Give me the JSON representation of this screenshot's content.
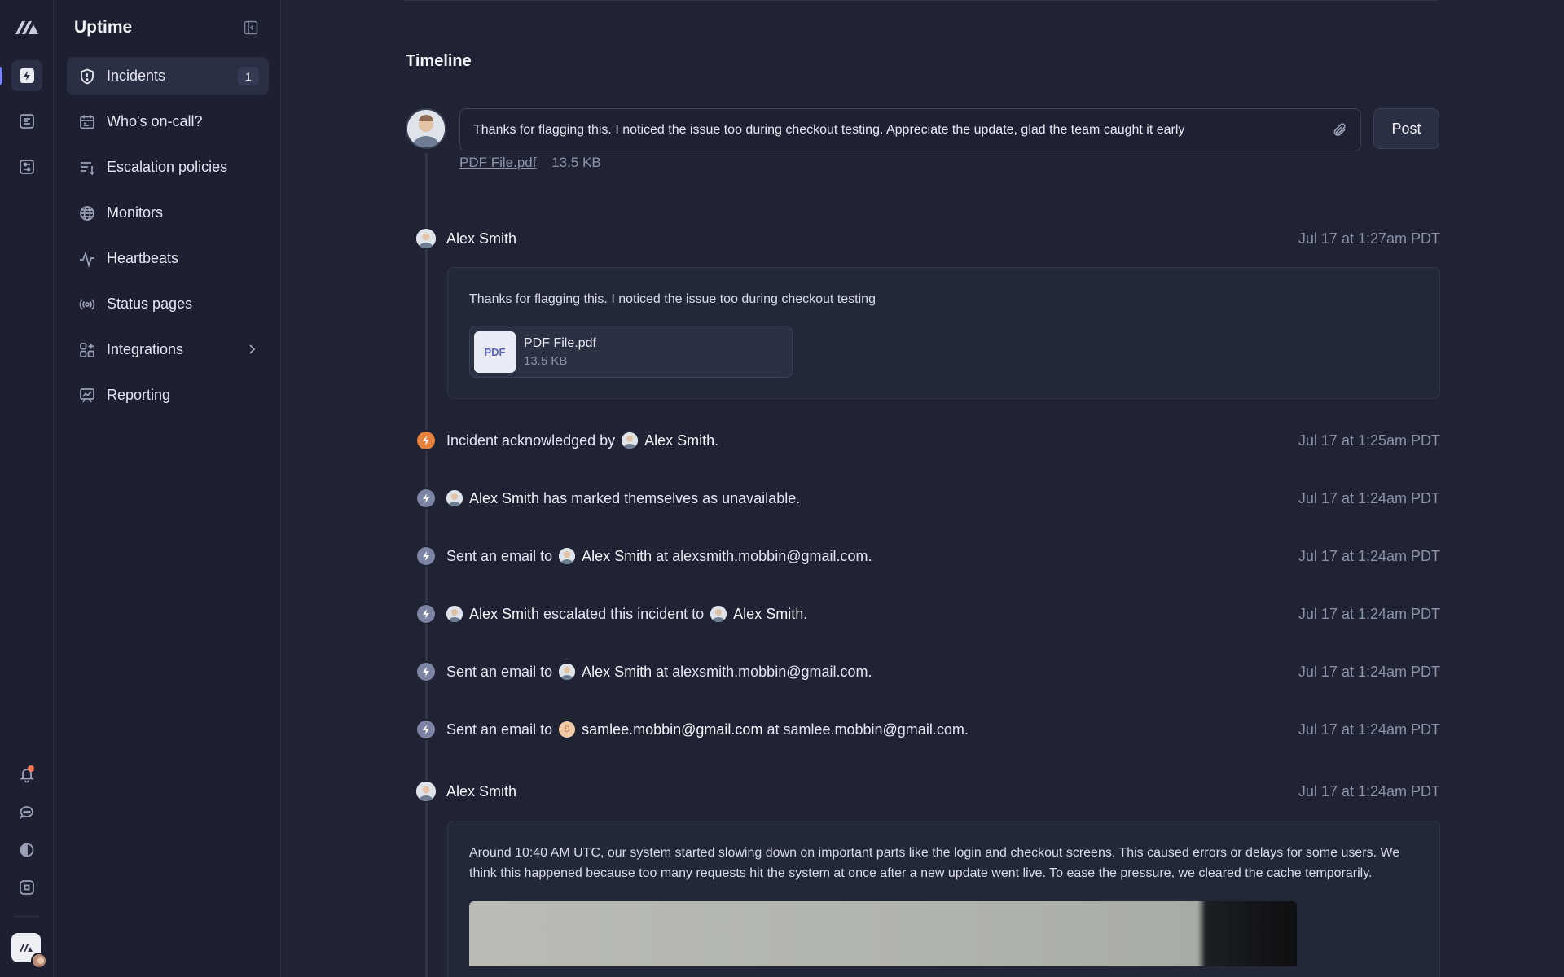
{
  "app": {
    "title": "Uptime"
  },
  "rail": {
    "icons": [
      "logo-icon",
      "incidents-icon",
      "document-icon",
      "settings-sliders-icon",
      "bell-icon",
      "chat-icon",
      "contrast-icon",
      "command-icon"
    ]
  },
  "sidebar": {
    "items": [
      {
        "label": "Incidents",
        "icon": "shield-alert-icon",
        "badge": "1",
        "active": true
      },
      {
        "label": "Who's on-call?",
        "icon": "calendar-icon"
      },
      {
        "label": "Escalation policies",
        "icon": "list-arrow-icon"
      },
      {
        "label": "Monitors",
        "icon": "globe-icon"
      },
      {
        "label": "Heartbeats",
        "icon": "pulse-icon"
      },
      {
        "label": "Status pages",
        "icon": "broadcast-icon"
      },
      {
        "label": "Integrations",
        "icon": "grid-plus-icon"
      },
      {
        "label": "Reporting",
        "icon": "chart-board-icon"
      }
    ]
  },
  "main": {
    "title": "Timeline",
    "composer": {
      "value": "Thanks for flagging this. I noticed the issue too during checkout testing. Appreciate the update, glad the team caught it early",
      "post_label": "Post",
      "attachment_name": "PDF File.pdf",
      "attachment_size": "13.5 KB"
    },
    "comment1": {
      "author": "Alex Smith",
      "time": "Jul 17 at 1:27am PDT",
      "text": "Thanks for flagging this. I noticed the issue too during checkout testing",
      "file_badge": "PDF",
      "file_name": "PDF File.pdf",
      "file_size": "13.5 KB"
    },
    "events": [
      {
        "pre": "Incident acknowledged by",
        "who": "Alex Smith",
        "post": ".",
        "time": "Jul 17 at 1:25am PDT"
      },
      {
        "who": "Alex Smith",
        "post": "has marked themselves as unavailable.",
        "time": "Jul 17 at 1:24am PDT"
      },
      {
        "pre": "Sent an email to",
        "who": "Alex Smith",
        "post": "at alexsmith.mobbin@gmail.com.",
        "time": "Jul 17 at 1:24am PDT"
      },
      {
        "who": "Alex Smith",
        "mid": "escalated this incident to",
        "who2": "Alex Smith",
        "post": ".",
        "time": "Jul 17 at 1:24am PDT"
      },
      {
        "pre": "Sent an email to",
        "who": "Alex Smith",
        "post": "at alexsmith.mobbin@gmail.com.",
        "time": "Jul 17 at 1:24am PDT"
      },
      {
        "pre": "Sent an email to",
        "avatar_letter": "S",
        "who": "samlee.mobbin@gmail.com",
        "post": "at samlee.mobbin@gmail.com.",
        "time": "Jul 17 at 1:24am PDT"
      }
    ],
    "comment2": {
      "author": "Alex Smith",
      "time": "Jul 17 at 1:24am PDT",
      "text": "Around 10:40 AM UTC, our system started slowing down on important parts like the login and checkout screens. This caused errors or delays for some users. We think this happened because too many requests hit the system at once after a new update went live. To ease the pressure, we cleared the cache temporarily."
    }
  },
  "colors": {
    "accent": "#7b83ff",
    "acknowledged": "#e5823b",
    "background": "#1f2333"
  }
}
